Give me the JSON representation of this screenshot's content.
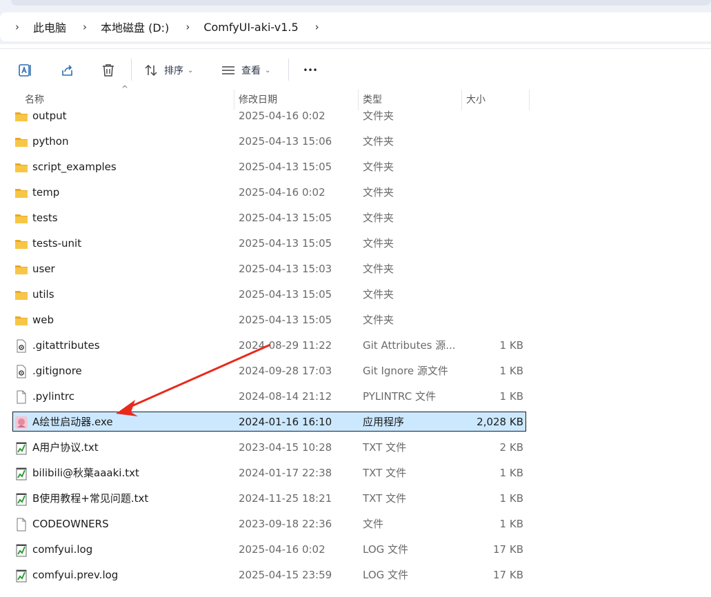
{
  "breadcrumb": [
    "此电脑",
    "本地磁盘 (D:)",
    "ComfyUI-aki-v1.5"
  ],
  "toolbar": {
    "sort_label": "排序",
    "view_label": "查看",
    "more_label": "•••"
  },
  "columns": {
    "name": "名称",
    "modified": "修改日期",
    "type": "类型",
    "size": "大小"
  },
  "files": [
    {
      "name": "output",
      "modified": "2025-04-16 0:02",
      "type": "文件夹",
      "size": "",
      "icon": "folder-icon"
    },
    {
      "name": "python",
      "modified": "2025-04-13 15:06",
      "type": "文件夹",
      "size": "",
      "icon": "folder-icon"
    },
    {
      "name": "script_examples",
      "modified": "2025-04-13 15:05",
      "type": "文件夹",
      "size": "",
      "icon": "folder-icon"
    },
    {
      "name": "temp",
      "modified": "2025-04-16 0:02",
      "type": "文件夹",
      "size": "",
      "icon": "folder-icon"
    },
    {
      "name": "tests",
      "modified": "2025-04-13 15:05",
      "type": "文件夹",
      "size": "",
      "icon": "folder-icon"
    },
    {
      "name": "tests-unit",
      "modified": "2025-04-13 15:05",
      "type": "文件夹",
      "size": "",
      "icon": "folder-icon"
    },
    {
      "name": "user",
      "modified": "2025-04-13 15:03",
      "type": "文件夹",
      "size": "",
      "icon": "folder-icon"
    },
    {
      "name": "utils",
      "modified": "2025-04-13 15:05",
      "type": "文件夹",
      "size": "",
      "icon": "folder-icon"
    },
    {
      "name": "web",
      "modified": "2025-04-13 15:05",
      "type": "文件夹",
      "size": "",
      "icon": "folder-icon"
    },
    {
      "name": ".gitattributes",
      "modified": "2024-08-29 11:22",
      "type": "Git Attributes 源...",
      "size": "1 KB",
      "icon": "config-file-icon"
    },
    {
      "name": ".gitignore",
      "modified": "2024-09-28 17:03",
      "type": "Git Ignore 源文件",
      "size": "1 KB",
      "icon": "config-file-icon"
    },
    {
      "name": ".pylintrc",
      "modified": "2024-08-14 21:12",
      "type": "PYLINTRC 文件",
      "size": "1 KB",
      "icon": "blank-file-icon"
    },
    {
      "name": "A绘世启动器.exe",
      "modified": "2024-01-16 16:10",
      "type": "应用程序",
      "size": "2,028 KB",
      "icon": "app-icon",
      "selected": true
    },
    {
      "name": "A用户协议.txt",
      "modified": "2023-04-15 10:28",
      "type": "TXT 文件",
      "size": "2 KB",
      "icon": "text-file-icon"
    },
    {
      "name": "bilibili@秋葉aaaki.txt",
      "modified": "2024-01-17 22:38",
      "type": "TXT 文件",
      "size": "1 KB",
      "icon": "text-file-icon"
    },
    {
      "name": "B使用教程+常见问题.txt",
      "modified": "2024-11-25 18:21",
      "type": "TXT 文件",
      "size": "1 KB",
      "icon": "text-file-icon"
    },
    {
      "name": "CODEOWNERS",
      "modified": "2023-09-18 22:36",
      "type": "文件",
      "size": "1 KB",
      "icon": "blank-file-icon"
    },
    {
      "name": "comfyui.log",
      "modified": "2025-04-16 0:02",
      "type": "LOG 文件",
      "size": "17 KB",
      "icon": "text-file-icon"
    },
    {
      "name": "comfyui.prev.log",
      "modified": "2025-04-15 23:59",
      "type": "LOG 文件",
      "size": "17 KB",
      "icon": "text-file-icon"
    }
  ],
  "colors": {
    "selection": "#cce8ff",
    "folder": "#f8c646",
    "arrow": "#e8291c"
  }
}
